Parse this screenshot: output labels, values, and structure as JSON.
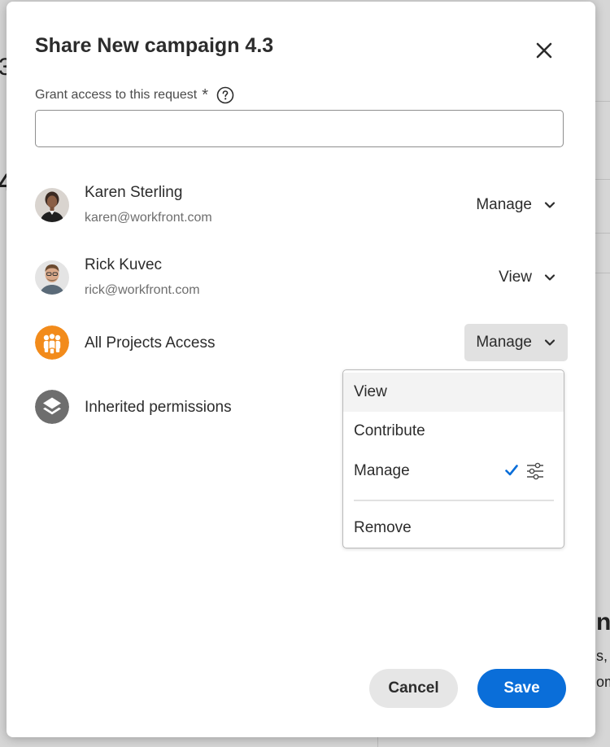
{
  "background": {
    "hint_left_top": "3",
    "hint_left_mid": "4",
    "hint_right_big": "nı",
    "hint_right_1": "s,",
    "hint_right_2": "om"
  },
  "dialog": {
    "title": "Share New campaign 4.3",
    "field_label": "Grant access to this request",
    "required_mark": "*",
    "input_value": "",
    "input_placeholder": ""
  },
  "people": [
    {
      "name": "Karen Sterling",
      "email": "karen@workfront.com",
      "permission": "Manage"
    },
    {
      "name": "Rick Kuvec",
      "email": "rick@workfront.com",
      "permission": "View"
    }
  ],
  "groups": [
    {
      "name": "All Projects Access",
      "permission": "Manage"
    },
    {
      "name": "Inherited permissions"
    }
  ],
  "permission_menu": {
    "items": [
      "View",
      "Contribute",
      "Manage",
      "Remove"
    ],
    "selected": "Manage",
    "highlighted": "View"
  },
  "actions": {
    "cancel_label": "Cancel",
    "save_label": "Save"
  },
  "colors": {
    "primary": "#0a6ed9",
    "group_orange": "#f28b1b",
    "inherited_gray": "#6e6e6e",
    "check_blue": "#0a6ed9"
  }
}
